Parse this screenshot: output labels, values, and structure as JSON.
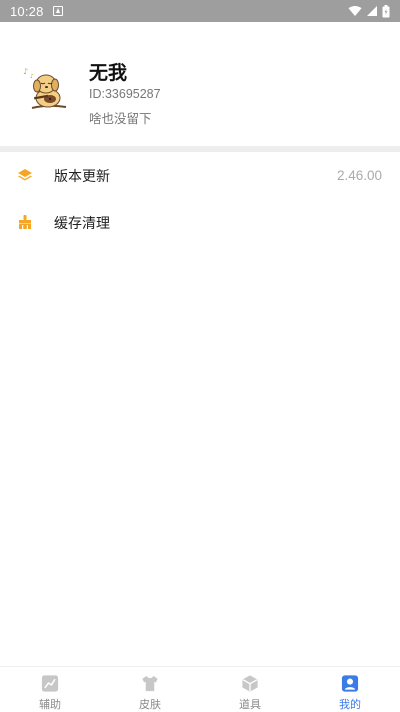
{
  "status_bar": {
    "time": "10:28"
  },
  "profile": {
    "name": "无我",
    "id_text": "ID:33695287",
    "bio": "啥也没留下"
  },
  "menu": {
    "items": [
      {
        "label": "版本更新",
        "value": "2.46.00",
        "icon": "layers-icon"
      },
      {
        "label": "缓存清理",
        "value": "",
        "icon": "broom-icon"
      }
    ]
  },
  "bottom_nav": {
    "items": [
      {
        "label": "辅助",
        "icon": "chart-icon",
        "active": false
      },
      {
        "label": "皮肤",
        "icon": "shirt-icon",
        "active": false
      },
      {
        "label": "道具",
        "icon": "cube-icon",
        "active": false
      },
      {
        "label": "我的",
        "icon": "profile-icon",
        "active": true
      }
    ]
  },
  "colors": {
    "accent": "#3a7be8",
    "menu_icon": "#f5a623",
    "nav_inactive": "#c7c7c7"
  }
}
